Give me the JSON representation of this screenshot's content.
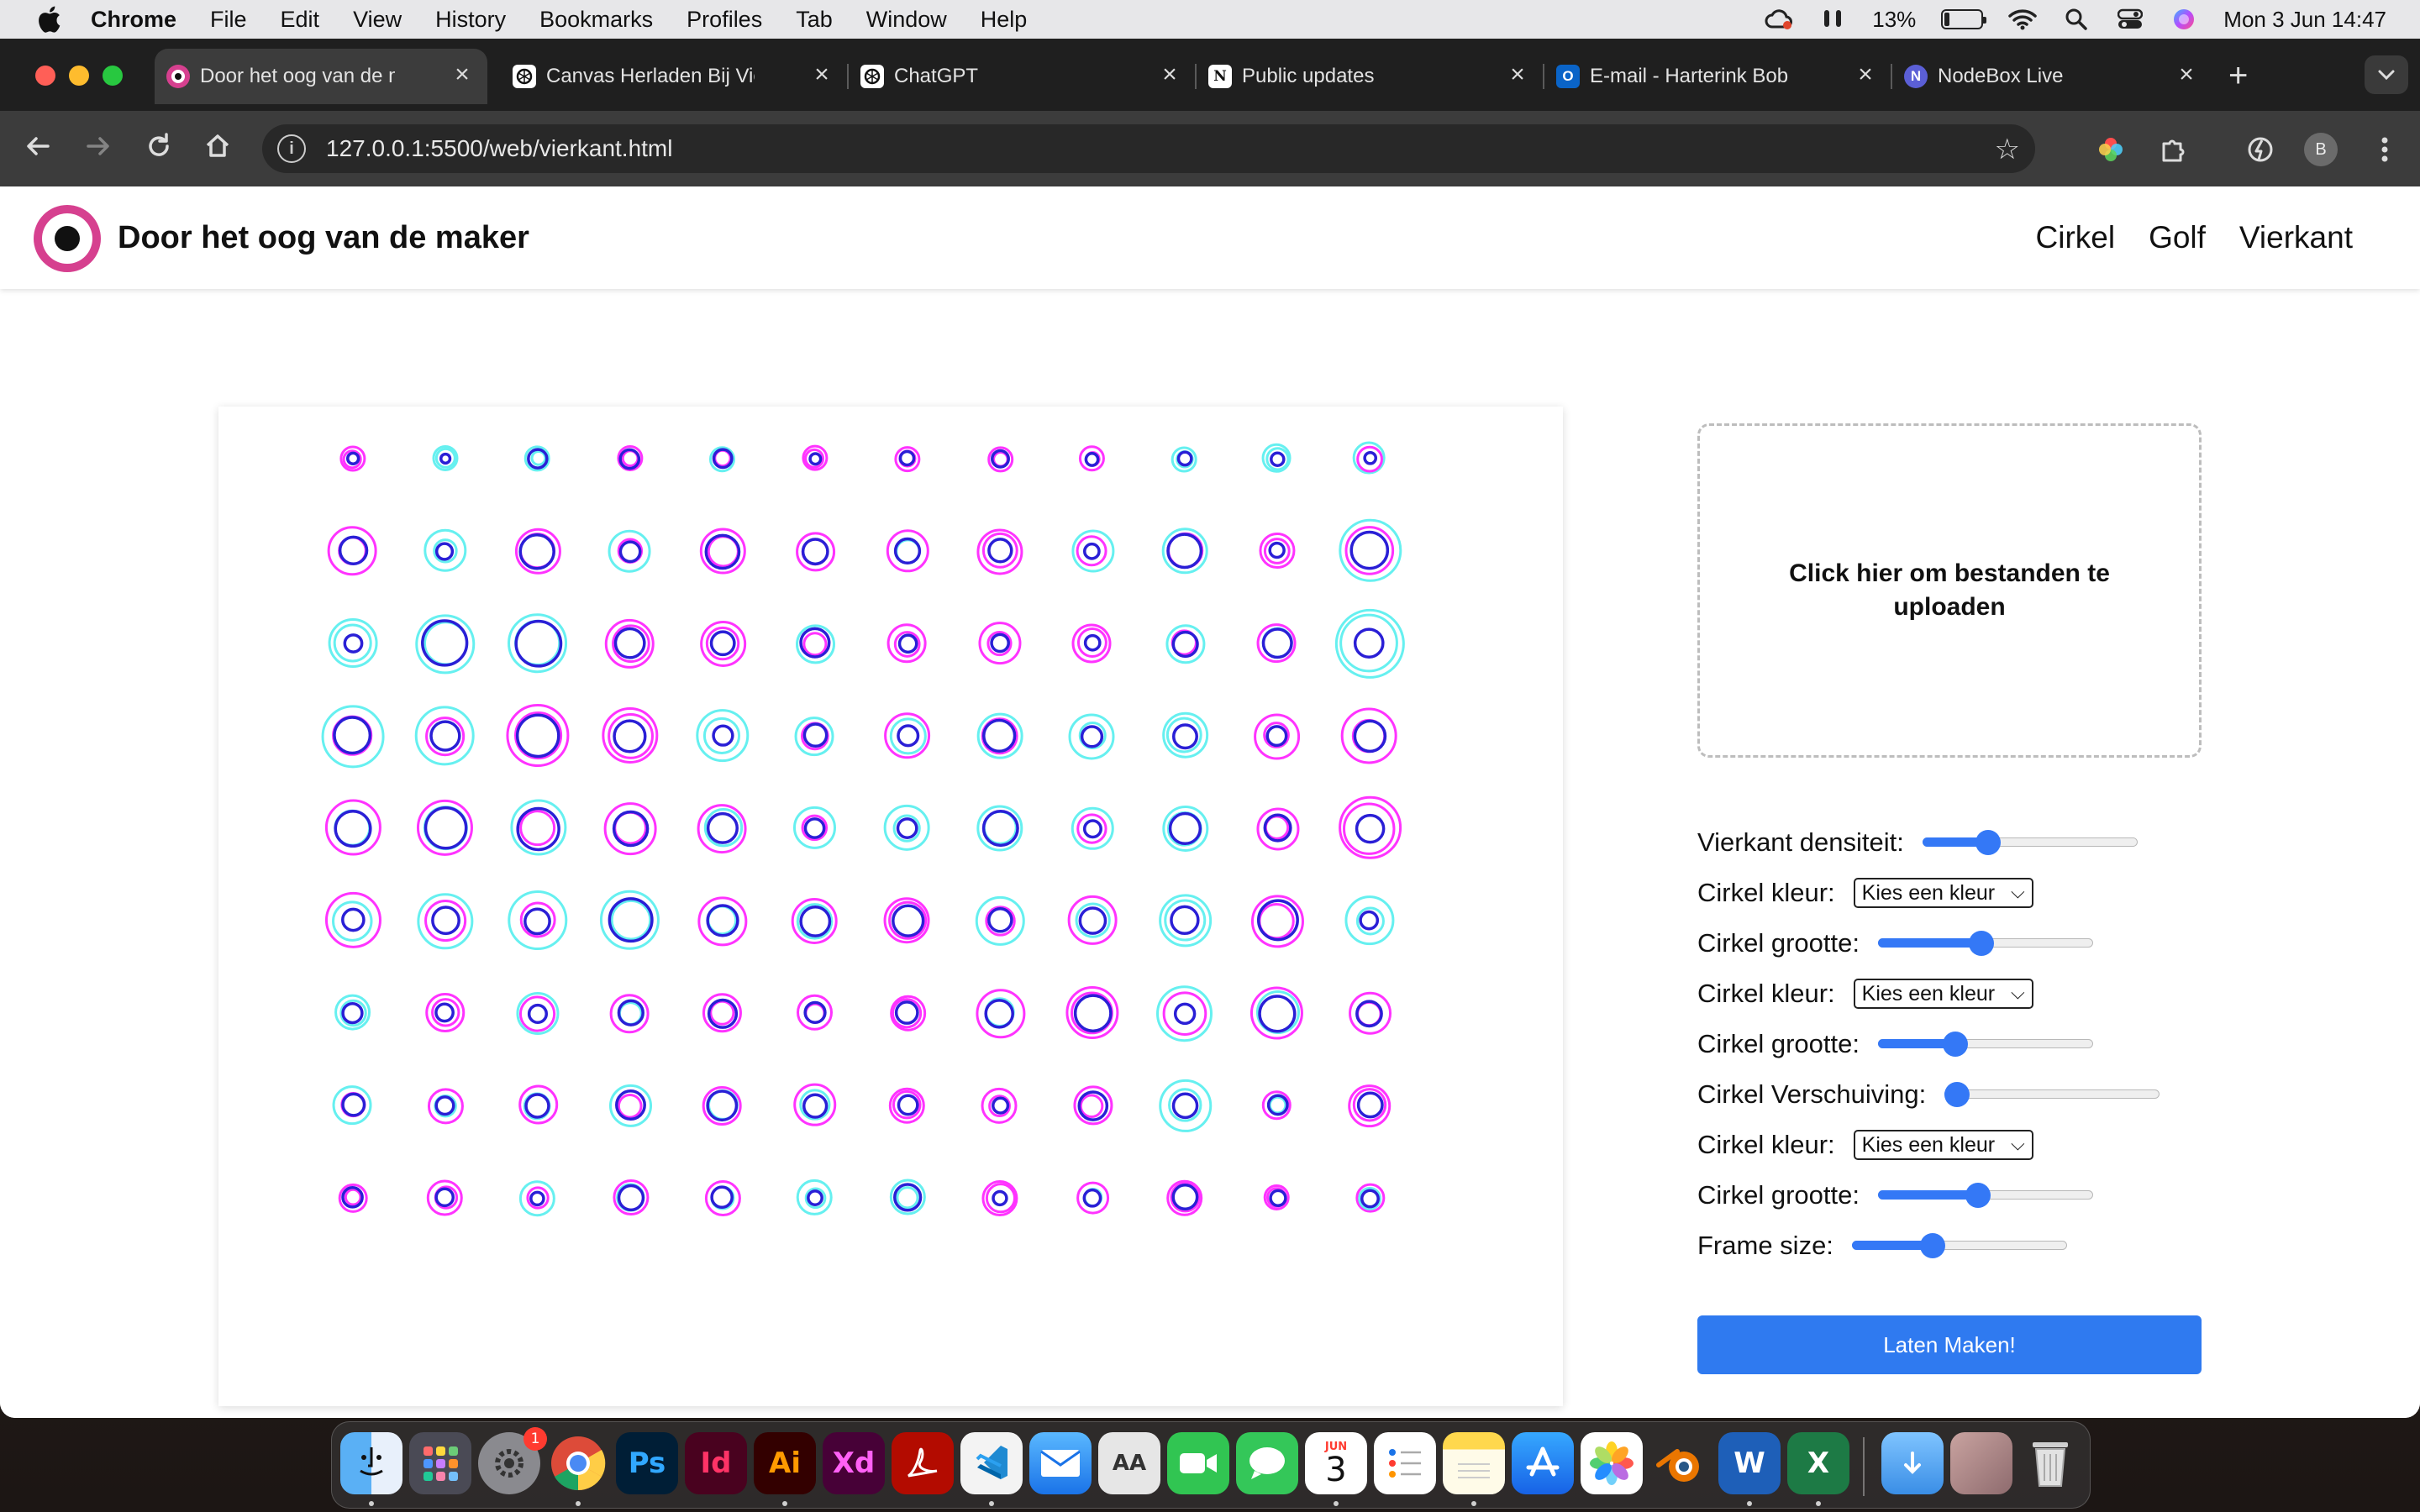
{
  "menubar": {
    "items": [
      "Chrome",
      "File",
      "Edit",
      "View",
      "History",
      "Bookmarks",
      "Profiles",
      "Tab",
      "Window",
      "Help"
    ],
    "battery": "13%",
    "datetime": "Mon 3 Jun  14:47",
    "battery_level": 0.13
  },
  "tabs": [
    {
      "title": "Door het oog van de maker",
      "icon": "eye-logo-icon",
      "active": true
    },
    {
      "title": "Canvas Herladen Bij Vierkant",
      "icon": "chatgpt-icon"
    },
    {
      "title": "ChatGPT",
      "icon": "chatgpt-icon"
    },
    {
      "title": "Public updates",
      "icon": "notion-icon"
    },
    {
      "title": "E-mail - Harterink Bob",
      "icon": "outlook-icon"
    },
    {
      "title": "NodeBox Live",
      "icon": "nodebox-icon"
    }
  ],
  "address": {
    "url": "127.0.0.1:5500/web/vierkant.html"
  },
  "profile_initial": "B",
  "site": {
    "title": "Door het oog van de maker",
    "nav": [
      "Cirkel",
      "Golf",
      "Vierkant"
    ]
  },
  "upload": {
    "label": "Click hier om bestanden te uploaden"
  },
  "controls": [
    {
      "type": "slider",
      "label": "Vierkant densiteit:",
      "value": 0.28
    },
    {
      "type": "select",
      "label": "Cirkel kleur:",
      "selected": "Kies een kleur"
    },
    {
      "type": "slider",
      "label": "Cirkel grootte:",
      "value": 0.48
    },
    {
      "type": "select",
      "label": "Cirkel kleur:",
      "selected": "Kies een kleur"
    },
    {
      "type": "slider",
      "label": "Cirkel grootte:",
      "value": 0.34
    },
    {
      "type": "slider",
      "label": "Cirkel Verschuiving:",
      "value": 0.0
    },
    {
      "type": "select",
      "label": "Cirkel kleur:",
      "selected": "Kies een kleur"
    },
    {
      "type": "slider",
      "label": "Cirkel grootte:",
      "value": 0.46
    },
    {
      "type": "slider",
      "label": "Frame size:",
      "value": 0.36
    }
  ],
  "submit_label": "Laten Maken!",
  "colors": {
    "accent": "#3478f6",
    "brand": "#d6408f",
    "ring_magenta": "#ff33ff",
    "ring_cyan": "#66f0f0",
    "ring_blue": "#2a1fd6"
  },
  "dock": [
    {
      "name": "finder-icon"
    },
    {
      "name": "launchpad-icon"
    },
    {
      "name": "system-settings-icon",
      "badge": "1"
    },
    {
      "name": "chrome-icon"
    },
    {
      "name": "photoshop-icon",
      "label": "Ps"
    },
    {
      "name": "indesign-icon",
      "label": "Id"
    },
    {
      "name": "illustrator-icon",
      "label": "Ai"
    },
    {
      "name": "xd-icon",
      "label": "Xd"
    },
    {
      "name": "acrobat-icon"
    },
    {
      "name": "vscode-icon"
    },
    {
      "name": "mail-icon"
    },
    {
      "name": "font-book-icon"
    },
    {
      "name": "facetime-icon"
    },
    {
      "name": "messages-icon"
    },
    {
      "name": "calendar-icon",
      "month": "JUN",
      "day": "3"
    },
    {
      "name": "reminders-icon"
    },
    {
      "name": "notes-icon"
    },
    {
      "name": "app-store-icon"
    },
    {
      "name": "photos-icon"
    },
    {
      "name": "blender-icon"
    },
    {
      "name": "word-icon"
    },
    {
      "name": "excel-icon"
    },
    {
      "name": "downloads-folder-icon"
    },
    {
      "name": "image-stack-icon"
    },
    {
      "name": "trash-icon"
    }
  ]
}
